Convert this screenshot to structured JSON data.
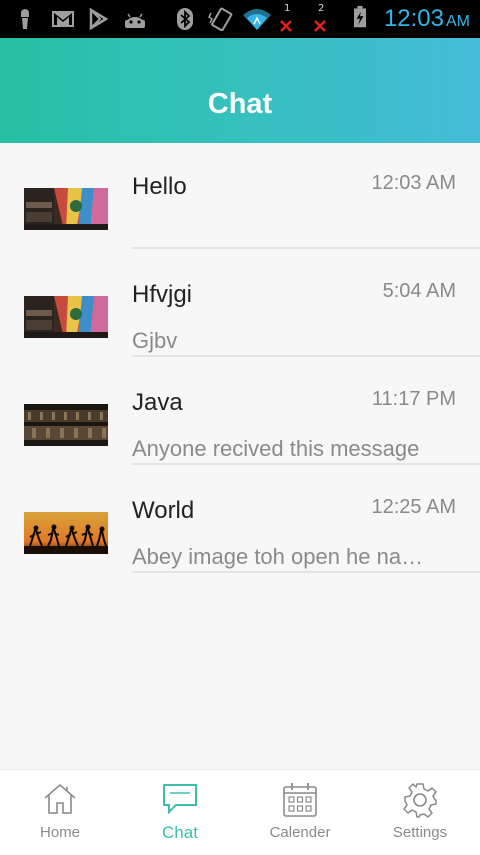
{
  "status_bar": {
    "time": "12:03",
    "ampm": "AM",
    "sim1_label": "1",
    "sim2_label": "2",
    "icons": [
      "usb-icon",
      "gmail-icon",
      "play-store-icon",
      "android-icon",
      "bluetooth-icon",
      "vibrate-icon",
      "wifi-icon",
      "no-signal-icon",
      "no-signal-icon",
      "battery-charging-icon"
    ],
    "time_color": "#34b5e5"
  },
  "header": {
    "title": "Chat"
  },
  "chats": [
    {
      "name": "Hello",
      "time": "12:03 AM",
      "preview": "",
      "thumb": "graffiti-thumbnail"
    },
    {
      "name": "Hfvjgi",
      "time": "5:04 AM",
      "preview": "Gjbv",
      "thumb": "graffiti-thumbnail"
    },
    {
      "name": "Java",
      "time": "11:17 PM",
      "preview": "Anyone recived this message",
      "thumb": "barrels-thumbnail"
    },
    {
      "name": "World",
      "time": "12:25 AM",
      "preview": "Abey image toh open he na…",
      "thumb": "sunset-runners-thumbnail"
    }
  ],
  "bottom_nav": {
    "items": [
      {
        "label": "Home",
        "icon": "home-icon"
      },
      {
        "label": "Chat",
        "icon": "chat-icon",
        "active": true
      },
      {
        "label": "Calender",
        "icon": "calendar-icon"
      },
      {
        "label": "Settings",
        "icon": "gear-icon"
      }
    ],
    "active_color": "#3ac0ad"
  },
  "colors": {
    "header_start": "#26bfa3",
    "header_end": "#45bcd9"
  }
}
